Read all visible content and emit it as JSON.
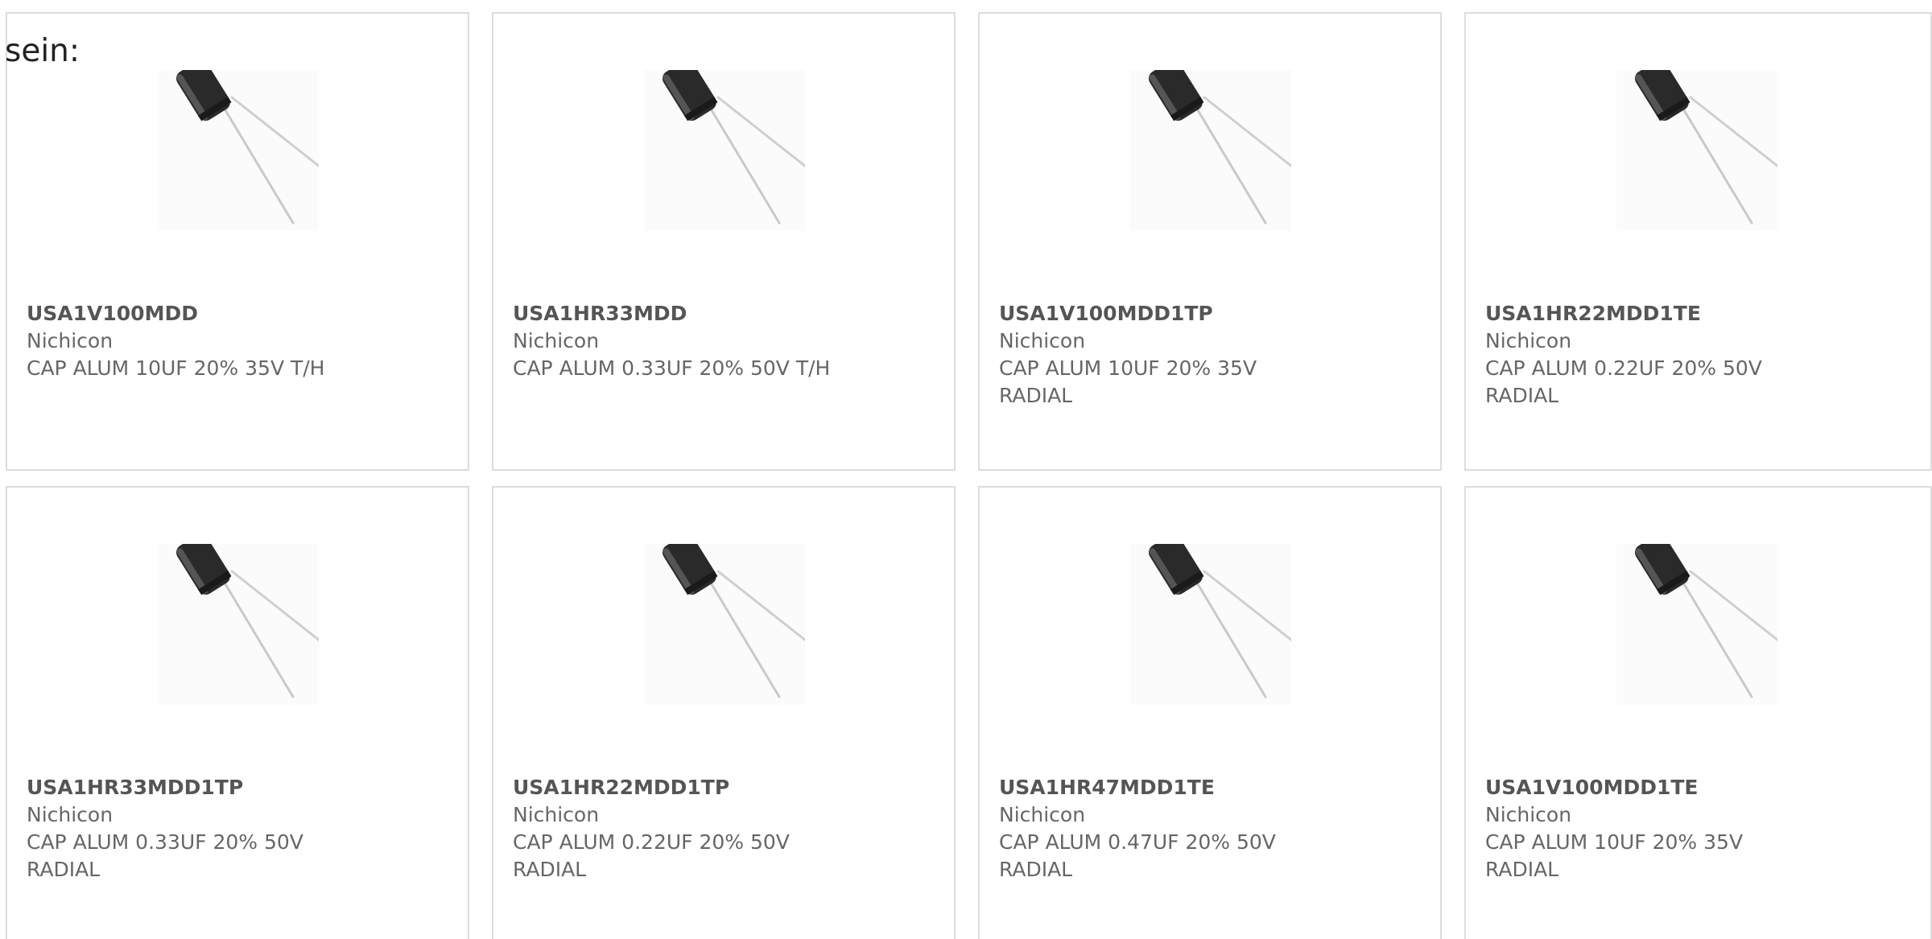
{
  "lead_text": "sein:",
  "colors": {
    "accent": "#e03c0e",
    "bar_track": "#3a3a3a",
    "card_border": "#dcdcdc",
    "text": "#666666"
  },
  "products": [
    {
      "part_number": "USA1V100MDD",
      "manufacturer": "Nichicon",
      "desc1": "CAP ALUM 10UF 20% 35V T/H",
      "desc2": "",
      "image_icon": "radial-capacitor-icon",
      "bar_fill": 0.32
    },
    {
      "part_number": "USA1HR33MDD",
      "manufacturer": "Nichicon",
      "desc1": "CAP ALUM 0.33UF 20% 50V T/H",
      "desc2": "",
      "image_icon": "radial-capacitor-icon",
      "bar_fill": 0.32
    },
    {
      "part_number": "USA1V100MDD1TP",
      "manufacturer": "Nichicon",
      "desc1": "CAP ALUM 10UF 20% 35V",
      "desc2": "RADIAL",
      "image_icon": "radial-capacitor-icon",
      "bar_fill": 0.32
    },
    {
      "part_number": "USA1HR22MDD1TE",
      "manufacturer": "Nichicon",
      "desc1": "CAP ALUM 0.22UF 20% 50V",
      "desc2": "RADIAL",
      "image_icon": "radial-capacitor-icon",
      "bar_fill": 0.32
    },
    {
      "part_number": "USA1HR33MDD1TP",
      "manufacturer": "Nichicon",
      "desc1": "CAP ALUM 0.33UF 20% 50V",
      "desc2": "RADIAL",
      "image_icon": "radial-capacitor-icon",
      "bar_fill": null
    },
    {
      "part_number": "USA1HR22MDD1TP",
      "manufacturer": "Nichicon",
      "desc1": "CAP ALUM 0.22UF 20% 50V",
      "desc2": "RADIAL",
      "image_icon": "radial-capacitor-icon",
      "bar_fill": null
    },
    {
      "part_number": "USA1HR47MDD1TE",
      "manufacturer": "Nichicon",
      "desc1": "CAP ALUM 0.47UF 20% 50V",
      "desc2": "RADIAL",
      "image_icon": "radial-capacitor-icon",
      "bar_fill": null
    },
    {
      "part_number": "USA1V100MDD1TE",
      "manufacturer": "Nichicon",
      "desc1": "CAP ALUM 10UF 20% 35V",
      "desc2": "RADIAL",
      "image_icon": "radial-capacitor-icon",
      "bar_fill": null
    }
  ]
}
